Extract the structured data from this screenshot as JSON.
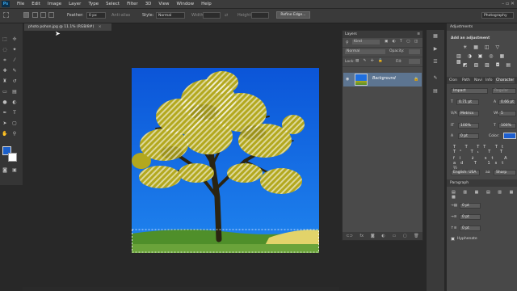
{
  "app": {
    "logo": "Ps"
  },
  "menu": [
    "File",
    "Edit",
    "Image",
    "Layer",
    "Type",
    "Select",
    "Filter",
    "3D",
    "View",
    "Window",
    "Help"
  ],
  "options": {
    "feather_label": "Feather:",
    "feather_value": "0 px",
    "antialias_label": "Anti-alias",
    "style_label": "Style:",
    "style_value": "Normal",
    "width_label": "Width:",
    "height_label": "Height:",
    "refine_button": "Refine Edge...",
    "workspace": "Photography"
  },
  "document": {
    "tab_title": "photo pohon.jpg @ 11.1% (RGB/8#)"
  },
  "layers": {
    "title": "Layers",
    "kind": "Kind",
    "blend": "Normal",
    "opacity_label": "Opacity:",
    "lock_label": "Lock:",
    "fill_label": "Fill:",
    "layer_name": "Background"
  },
  "adjustments": {
    "tab": "Adjustments",
    "heading": "Add an adjustment"
  },
  "character": {
    "tabs": [
      "Clon",
      "Path",
      "Navi",
      "Info",
      "Character"
    ],
    "font_family": "Impact",
    "font_style": "Regular",
    "size": "0.71 pt",
    "leading": "0.66 pt",
    "kerning": "Metrics",
    "tracking": "5",
    "vscale": "100%",
    "hscale": "100%",
    "baseline": "0 pt",
    "color_label": "Color:",
    "color": "#1d5fd0",
    "language": "English: USA",
    "aa": "Sharp"
  },
  "paragraph": {
    "title": "Paragraph",
    "indent_left": "0 pt",
    "indent_first": "0 pt",
    "space_before": "0 pt",
    "hyphenate": "Hyphenate"
  }
}
